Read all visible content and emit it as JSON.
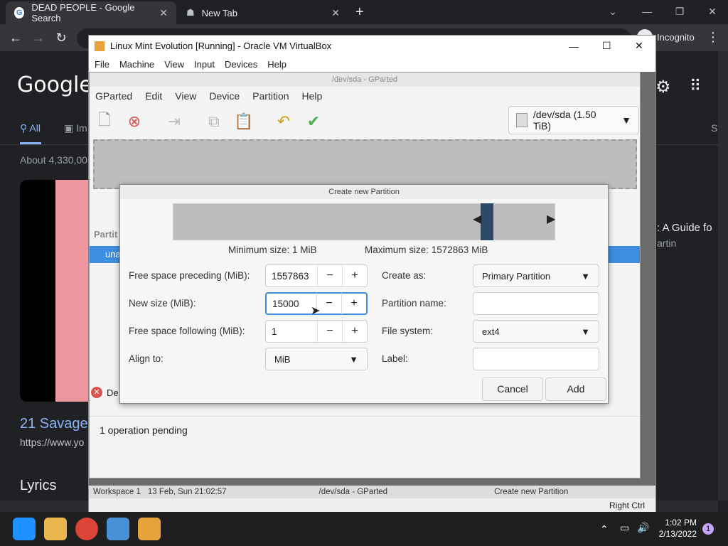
{
  "browser": {
    "tabs": [
      {
        "title": "DEAD PEOPLE - Google Search"
      },
      {
        "title": "New Tab"
      }
    ],
    "incognito_label": "Incognito",
    "nav_icons": [
      "back-icon",
      "forward-icon",
      "reload-icon"
    ]
  },
  "google": {
    "logo": "Google",
    "tab_all": "All",
    "tab_images": "Im",
    "tab_s": "S",
    "results_count": "About 4,330,00",
    "result_title": "21 Savage",
    "result_url": "https://www.yo",
    "side_title": ": A Guide fo",
    "side_sub": "artin",
    "lyrics": "Lyrics"
  },
  "vbox": {
    "title": "Linux Mint Evolution [Running] - Oracle VM VirtualBox",
    "menu": [
      "File",
      "Machine",
      "View",
      "Input",
      "Devices",
      "Help"
    ],
    "host_key": "Right Ctrl"
  },
  "gparted": {
    "title": "/dev/sda - GParted",
    "menu": [
      "GParted",
      "Edit",
      "View",
      "Device",
      "Partition",
      "Help"
    ],
    "device": "/dev/sda (1.50 TiB)",
    "list_header": "Partit",
    "list_row": "una",
    "details_label": "De",
    "status": "1 operation pending"
  },
  "dialog": {
    "title": "Create new Partition",
    "min_size": "Minimum size: 1 MiB",
    "max_size": "Maximum size: 1572863 MiB",
    "free_preceding_label": "Free space preceding (MiB):",
    "free_preceding_value": "1557863",
    "new_size_label": "New size (MiB):",
    "new_size_value": "15000",
    "free_following_label": "Free space following (MiB):",
    "free_following_value": "1",
    "align_label": "Align to:",
    "align_value": "MiB",
    "create_as_label": "Create as:",
    "create_as_value": "Primary Partition",
    "partition_name_label": "Partition name:",
    "partition_name_value": "",
    "file_system_label": "File system:",
    "file_system_value": "ext4",
    "label_label": "Label:",
    "label_value": "",
    "cancel": "Cancel",
    "add": "Add",
    "minus": "−",
    "plus": "+"
  },
  "guest_panel": {
    "workspace": "Workspace 1",
    "datetime": "13 Feb, Sun 21:02:57",
    "task1": "/dev/sda - GParted",
    "task2": "Create new Partition"
  },
  "taskbar": {
    "time": "1:02 PM",
    "date": "2/13/2022",
    "notifications": "1"
  }
}
